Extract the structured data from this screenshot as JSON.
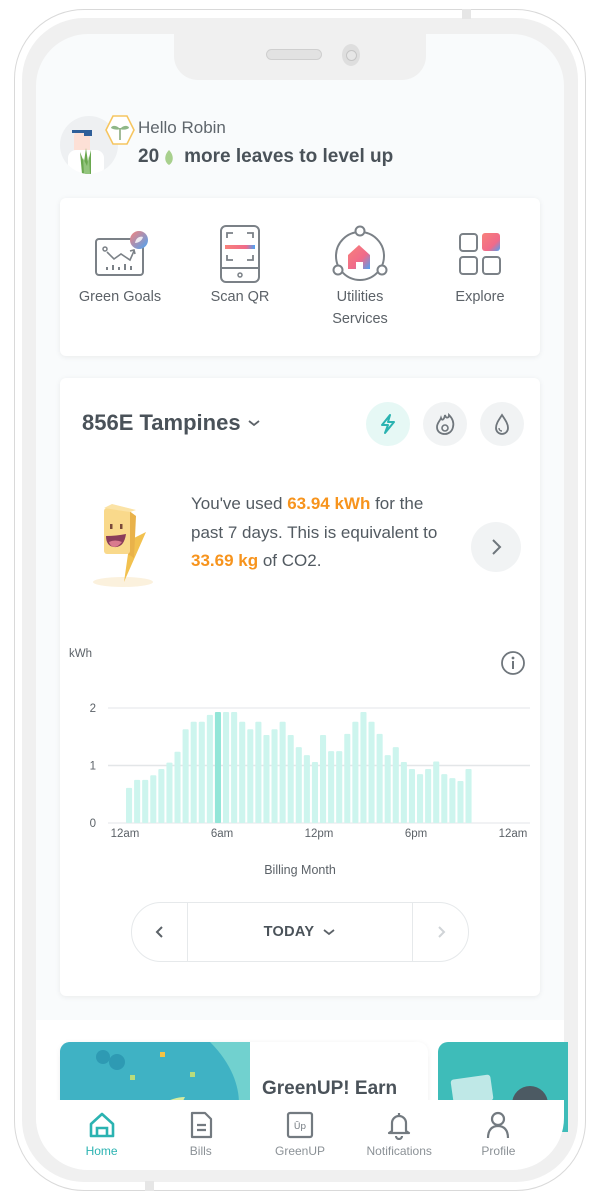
{
  "greeting": {
    "hello": "Hello Robin",
    "leaves_count": "20",
    "leaves_text": "more leaves to level up"
  },
  "quick_actions": [
    {
      "label": "Green Goals",
      "icon": "green-goals-icon"
    },
    {
      "label": "Scan QR",
      "icon": "scan-qr-icon"
    },
    {
      "label": "Utilities Services",
      "icon": "utilities-services-icon"
    },
    {
      "label": "Explore",
      "icon": "explore-icon"
    }
  ],
  "energy": {
    "address": "856E Tampines",
    "utilities": [
      {
        "name": "electricity",
        "icon": "lightning-icon",
        "active": true
      },
      {
        "name": "gas",
        "icon": "flame-icon",
        "active": false
      },
      {
        "name": "water",
        "icon": "water-drop-icon",
        "active": false
      }
    ],
    "usage": {
      "prefix": "You've used ",
      "kwh": "63.94 kWh",
      "middle": " for the past 7 days. This is equivalent to ",
      "co2": "33.69 kg",
      "suffix": " of CO2."
    },
    "period": {
      "label": "TODAY"
    }
  },
  "chart_data": {
    "type": "bar",
    "title": "",
    "xlabel": "Billing Month",
    "ylabel": "kWh",
    "ylim": [
      0,
      2
    ],
    "yticks": [
      0,
      1,
      2
    ],
    "xtick_labels": [
      "12am",
      "6am",
      "12pm",
      "6pm",
      "12am"
    ],
    "slot_count": 48,
    "highlight_index": 11,
    "categories": [
      "00:00",
      "00:30",
      "01:00",
      "01:30",
      "02:00",
      "02:30",
      "03:00",
      "03:30",
      "04:00",
      "04:30",
      "05:00",
      "05:30",
      "06:00",
      "06:30",
      "07:00",
      "07:30",
      "08:00",
      "08:30",
      "09:00",
      "09:30",
      "10:00",
      "10:30",
      "11:00",
      "11:30",
      "12:00",
      "12:30",
      "13:00",
      "13:30",
      "14:00",
      "14:30",
      "15:00",
      "15:30",
      "16:00",
      "16:30",
      "17:00",
      "17:30",
      "18:00",
      "18:30",
      "19:00",
      "19:30",
      "20:00",
      "20:30",
      "21:00"
    ],
    "values": [
      0.61,
      0.75,
      0.75,
      0.83,
      0.94,
      1.05,
      1.24,
      1.63,
      1.76,
      1.76,
      1.88,
      1.93,
      1.93,
      1.93,
      1.76,
      1.63,
      1.76,
      1.53,
      1.63,
      1.76,
      1.53,
      1.32,
      1.18,
      1.06,
      1.53,
      1.25,
      1.25,
      1.55,
      1.76,
      1.93,
      1.76,
      1.55,
      1.18,
      1.32,
      1.06,
      0.94,
      0.85,
      0.94,
      1.07,
      0.85,
      0.78,
      0.73,
      0.94
    ],
    "grid": true,
    "colors": {
      "bar": "#cdf5ee",
      "highlight": "#93e6d8",
      "grid": "#e3e6e8"
    }
  },
  "promo": {
    "title": "GreenUP! Earn"
  },
  "tabbar": [
    {
      "label": "Home",
      "icon": "home-icon",
      "active": true
    },
    {
      "label": "Bills",
      "icon": "bills-icon",
      "active": false
    },
    {
      "label": "GreenUP",
      "icon": "greenup-icon",
      "active": false
    },
    {
      "label": "Notifications",
      "icon": "bell-icon",
      "active": false
    },
    {
      "label": "Profile",
      "icon": "profile-icon",
      "active": false
    }
  ],
  "colors": {
    "accent": "#2bb3b1",
    "highlight_text": "#f7941d",
    "text": "#4a5259"
  }
}
